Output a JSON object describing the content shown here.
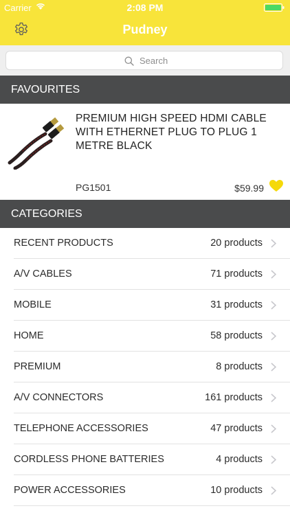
{
  "status_bar": {
    "carrier": "Carrier",
    "time": "2:08 PM"
  },
  "navbar": {
    "title": "Pudney",
    "settings_icon": "gear-icon"
  },
  "search": {
    "placeholder": "Search"
  },
  "favourites": {
    "header": "FAVOURITES",
    "item": {
      "name": "PREMIUM HIGH SPEED HDMI CABLE WITH ETHERNET PLUG TO PLUG 1 METRE BLACK",
      "code": "PG1501",
      "price": "$59.99",
      "favourite_icon": "heart-icon"
    }
  },
  "categories": {
    "header": "CATEGORIES",
    "items": [
      {
        "label": "RECENT PRODUCTS",
        "count": "20 products"
      },
      {
        "label": "A/V CABLES",
        "count": "71 products"
      },
      {
        "label": "MOBILE",
        "count": "31 products"
      },
      {
        "label": "HOME",
        "count": "58 products"
      },
      {
        "label": "PREMIUM",
        "count": "8 products"
      },
      {
        "label": "A/V CONNECTORS",
        "count": "161 products"
      },
      {
        "label": "TELEPHONE ACCESSORIES",
        "count": "47 products"
      },
      {
        "label": "CORDLESS PHONE BATTERIES",
        "count": "4 products"
      },
      {
        "label": "POWER ACCESSORIES",
        "count": "10 products"
      }
    ]
  },
  "colors": {
    "accent": "#f8e43a",
    "header_bg": "#4a4b4c",
    "heart": "#f5d90a",
    "battery": "#4cd964"
  }
}
